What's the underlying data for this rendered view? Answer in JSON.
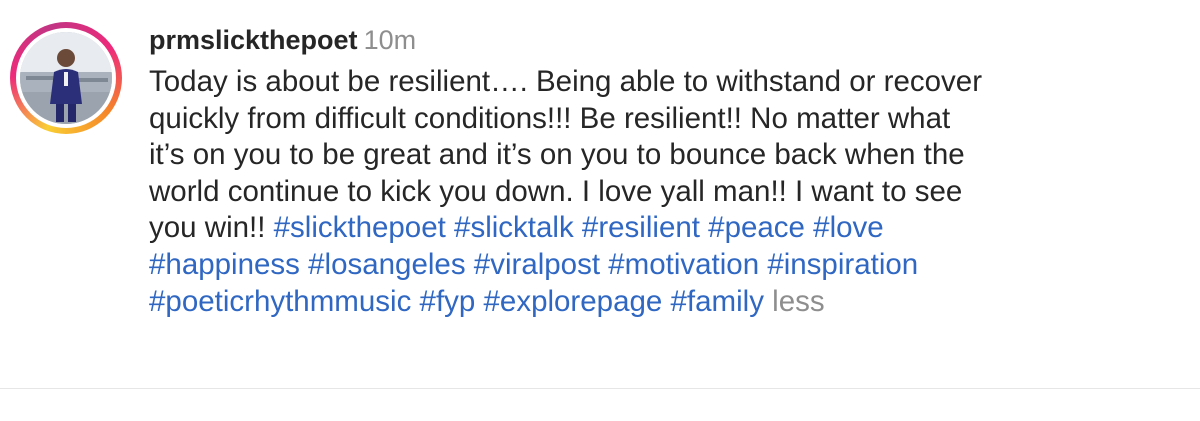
{
  "post": {
    "username": "prmslickthepoet",
    "timestamp": "10m",
    "caption_lines": [
      "Today is about be resilient…. Being able to withstand or recover",
      "quickly from difficult conditions!!! Be resilient!! No matter what",
      "it’s on you to be great and it’s on you to bounce back when the",
      "world continue to kick you down. I love yall man!! I want to see",
      "you win!!"
    ],
    "hashtags": {
      "slickthepoet": "#slickthepoet",
      "slicktalk": "#slicktalk",
      "resilient": "#resilient",
      "peace": "#peace",
      "love": "#love",
      "happiness": "#happiness",
      "losangeles": "#losangeles",
      "viralpost": "#viralpost",
      "motivation": "#motivation",
      "inspiration": "#inspiration",
      "poeticrhythmmusic": "#poeticrhythmmusic",
      "fyp": "#fyp",
      "explorepage": "#explorepage",
      "family": "#family"
    },
    "less_label": "less"
  },
  "colors": {
    "hashtag": "#2f67c2",
    "muted": "#8e8e8e",
    "text": "#262626"
  }
}
